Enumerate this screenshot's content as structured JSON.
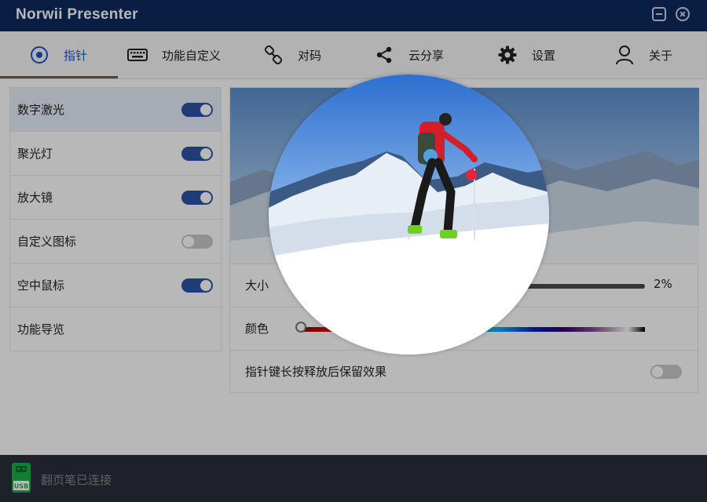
{
  "window": {
    "title": "Norwii Presenter"
  },
  "tabs": [
    {
      "label": "指针",
      "icon": "target-icon",
      "active": true
    },
    {
      "label": "功能自定义",
      "icon": "keyboard-icon"
    },
    {
      "label": "对码",
      "icon": "link-icon"
    },
    {
      "label": "云分享",
      "icon": "share-icon"
    },
    {
      "label": "设置",
      "icon": "gear-icon"
    },
    {
      "label": "关于",
      "icon": "user-icon"
    }
  ],
  "sidebar": {
    "items": [
      {
        "label": "数字激光",
        "toggle": "on",
        "active": true
      },
      {
        "label": "聚光灯",
        "toggle": "on"
      },
      {
        "label": "放大镜",
        "toggle": "on"
      },
      {
        "label": "自定义图标",
        "toggle": "off"
      },
      {
        "label": "空中鼠标",
        "toggle": "on"
      },
      {
        "label": "功能导览"
      }
    ]
  },
  "settings": {
    "size_label": "大小",
    "size_value": "2%",
    "size_fraction": 0.02,
    "color_label": "颜色",
    "retain_label": "指针键长按释放后保留效果",
    "retain_toggle": "off"
  },
  "laser_color": "#e8253b",
  "accent_color": "#2b54a8",
  "status": {
    "text": "翻页笔已连接",
    "icon": "usb-icon",
    "usb_label": "USB"
  }
}
